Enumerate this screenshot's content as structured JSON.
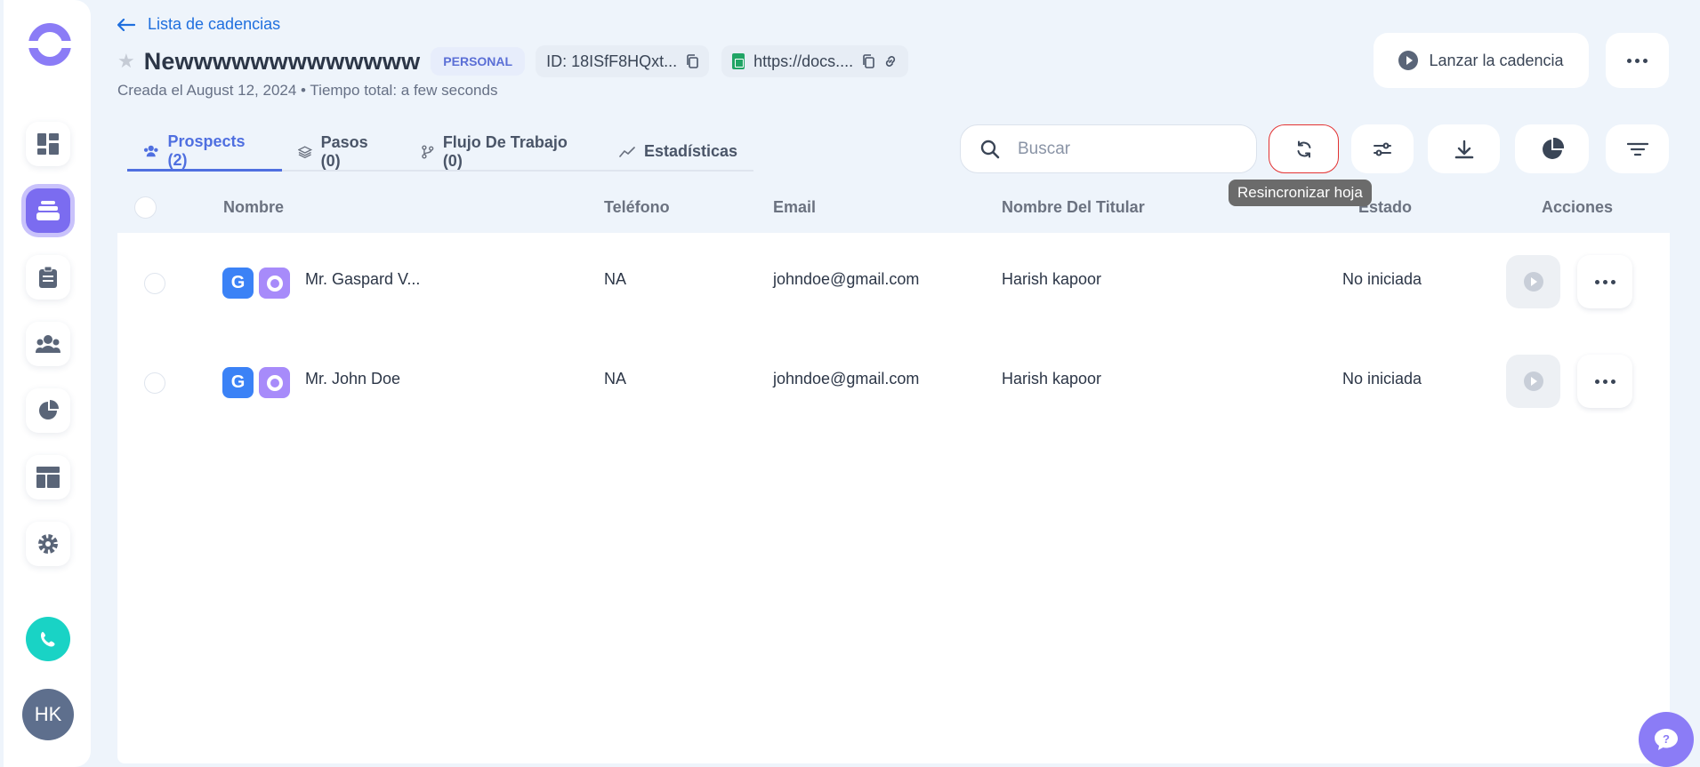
{
  "header": {
    "back_label": "Lista de cadencias",
    "title": "Newwwwwwwwwwwww",
    "badge": "PERSONAL",
    "id_chip": "ID: 18ISfF8HQxt...",
    "url_chip": "https://docs....",
    "subtitle": "Creada el August 12, 2024 • Tiempo total: a few seconds",
    "launch_label": "Lanzar la cadencia"
  },
  "sidebar": {
    "items": [
      "dashboard",
      "cadences",
      "tasks",
      "people",
      "reports",
      "templates",
      "settings"
    ],
    "active": "cadences",
    "avatar": "HK"
  },
  "tabs": [
    {
      "label": "Prospects (2)",
      "icon": "people-icon",
      "active": true
    },
    {
      "label": "Pasos (0)",
      "icon": "layers-icon",
      "active": false
    },
    {
      "label": "Flujo De Trabajo (0)",
      "icon": "branch-icon",
      "active": false
    },
    {
      "label": "Estadísticas",
      "icon": "trend-icon",
      "active": false
    }
  ],
  "search": {
    "placeholder": "Buscar"
  },
  "tooltip": "Resincronizar hoja",
  "table": {
    "headers": [
      "Nombre",
      "Teléfono",
      "Email",
      "Nombre Del Titular",
      "Estado",
      "Acciones"
    ],
    "rows": [
      {
        "name": "Mr. Gaspard V...",
        "phone": "NA",
        "email": "johndoe@gmail.com",
        "owner": "Harish kapoor",
        "status": "No iniciada"
      },
      {
        "name": "Mr. John Doe",
        "phone": "NA",
        "email": "johndoe@gmail.com",
        "owner": "Harish kapoor",
        "status": "No iniciada"
      }
    ]
  },
  "colors": {
    "accent": "#4f6fe0",
    "brand": "#7b6cf0",
    "highlight": "#e33232"
  }
}
